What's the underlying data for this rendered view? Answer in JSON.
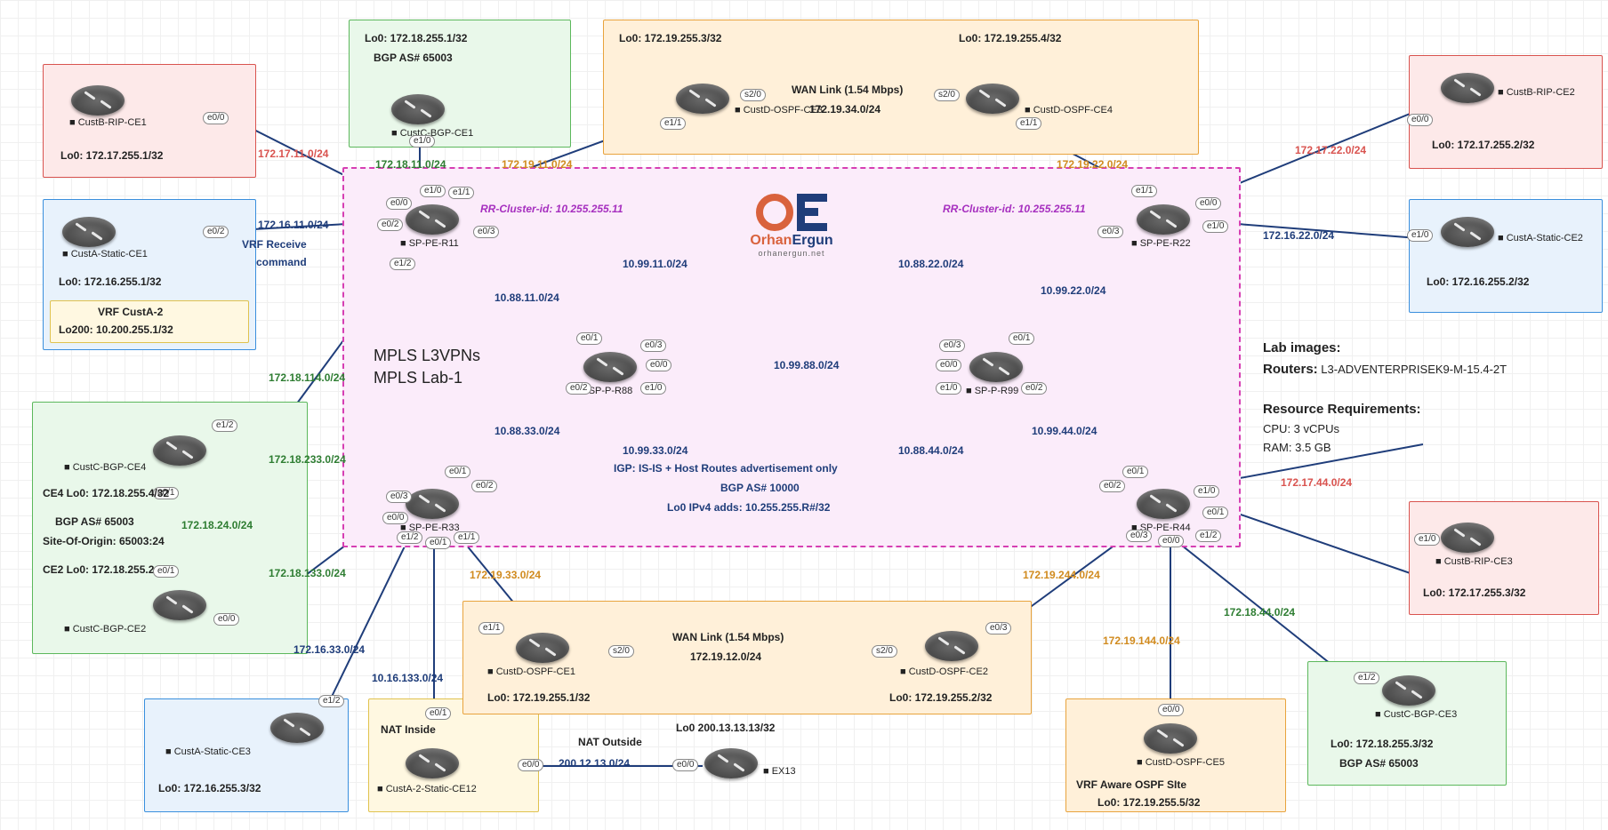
{
  "core": {
    "title1": "MPLS L3VPNs",
    "title2": "MPLS Lab-1",
    "rr_left": "RR-Cluster-id: 10.255.255.11",
    "rr_right": "RR-Cluster-id: 10.255.255.11",
    "igp1": "IGP: IS-IS + Host Routes advertisement only",
    "igp2": "BGP AS# 10000",
    "igp3": "Lo0 IPv4 adds: 10.255.255.R#/32",
    "links": {
      "l_10_99_11": "10.99.11.0/24",
      "l_10_88_22": "10.88.22.0/24",
      "l_10_99_22": "10.99.22.0/24",
      "l_10_88_11": "10.88.11.0/24",
      "l_10_99_88": "10.99.88.0/24",
      "l_10_88_33": "10.88.33.0/24",
      "l_10_99_33": "10.99.33.0/24",
      "l_10_88_44": "10.88.44.0/24",
      "l_10_99_44": "10.99.44.0/24"
    },
    "nodes": {
      "r11": "SP-PE-R11",
      "r22": "SP-PE-R22",
      "r33": "SP-PE-R33",
      "r44": "SP-PE-R44",
      "r88": "SP-P-R88",
      "r99": "SP-P-R99"
    }
  },
  "logo": {
    "name_left": "Orhan",
    "name_right": "Ergun",
    "sub": "orhanergun.net"
  },
  "custA1": {
    "name": "CustA-Static-CE1",
    "lo": "Lo0: 172.16.255.1/32",
    "vrf1": "VRF CustA-2",
    "vrf2": "Lo200: 10.200.255.1/32"
  },
  "custA2": {
    "name": "CustA-Static-CE2",
    "lo": "Lo0: 172.16.255.2/32"
  },
  "custA3": {
    "name": "CustA-Static-CE3",
    "lo": "Lo0: 172.16.255.3/32"
  },
  "custB1": {
    "name": "CustB-RIP-CE1",
    "lo": "Lo0: 172.17.255.1/32"
  },
  "custB2": {
    "name": "CustB-RIP-CE2",
    "lo": "Lo0: 172.17.255.2/32"
  },
  "custB3": {
    "name": "CustB-RIP-CE3",
    "lo": "Lo0: 172.17.255.3/32"
  },
  "custC1": {
    "name": "CustC-BGP-CE1",
    "lo": "Lo0: 172.18.255.1/32",
    "as": "BGP AS# 65003"
  },
  "custC3": {
    "name": "CustC-BGP-CE3",
    "lo": "Lo0: 172.18.255.3/32",
    "as": "BGP AS# 65003"
  },
  "custC_grp": {
    "ce4": "CustC-BGP-CE4",
    "ce4lo": "CE4 Lo0: 172.18.255.4/32",
    "as": "BGP AS# 65003",
    "soo": "Site-Of-Origin: 65003:24",
    "ce2lo": "CE2 Lo0: 172.18.255.2",
    "ce2": "CustC-BGP-CE2"
  },
  "custD_top": {
    "ce3": "CustD-OSPF-CE3",
    "ce3lo": "Lo0: 172.19.255.3/32",
    "ce4": "CustD-OSPF-CE4",
    "ce4lo": "Lo0: 172.19.255.4/32",
    "wan": "WAN Link (1.54 Mbps)",
    "wanip": "172.19.34.0/24"
  },
  "custD_bot": {
    "ce1": "CustD-OSPF-CE1",
    "ce1lo": "Lo0: 172.19.255.1/32",
    "ce2": "CustD-OSPF-CE2",
    "ce2lo": "Lo0: 172.19.255.2/32",
    "wan": "WAN Link (1.54 Mbps)",
    "wanip": "172.19.12.0/24"
  },
  "custD5": {
    "name": "CustD-OSPF-CE5",
    "vrf": "VRF Aware OSPF SIte",
    "lo": "Lo0: 172.19.255.5/32"
  },
  "nat": {
    "ce": "CustA-2-Static-CE12",
    "inside": "NAT Inside",
    "outside": "NAT Outside",
    "link": "200.12.13.0/24",
    "ex": "EX13",
    "exlo": "Lo0 200.13.13.13/32"
  },
  "edge_links": {
    "a11": "172.16.11.0/24",
    "a22": "172.16.22.0/24",
    "a33": "172.16.33.0/24",
    "b11": "172.17.11.0/24",
    "b22": "172.17.22.0/24",
    "b44": "172.17.44.0/24",
    "c11": "172.18.11.0/24",
    "c44": "172.18.44.0/24",
    "c114": "172.18.114.0/24",
    "c233": "172.18.233.0/24",
    "c24": "172.18.24.0/24",
    "c133": "172.18.133.0/24",
    "d11": "172.19.11.0/24",
    "d22": "172.19.22.0/24",
    "d33": "172.19.33.0/24",
    "d244": "172.19.244.0/24",
    "d144": "172.19.144.0/24",
    "a133": "10.16.133.0/24",
    "vrf_note1": "VRF Receive",
    "vrf_note2": "command"
  },
  "info": {
    "lab_h": "Lab images:",
    "lab_r_h": "Routers:",
    "lab_r": "L3-ADVENTERPRISEK9-M-15.4-2T",
    "req_h": "Resource Requirements:",
    "cpu": "CPU: 3 vCPUs",
    "ram": "RAM: 3.5 GB"
  },
  "if": {
    "e00": "e0/0",
    "e01": "e0/1",
    "e02": "e0/2",
    "e03": "e0/3",
    "e10": "e1/0",
    "e11": "e1/1",
    "e12": "e1/2",
    "s20": "s2/0"
  }
}
